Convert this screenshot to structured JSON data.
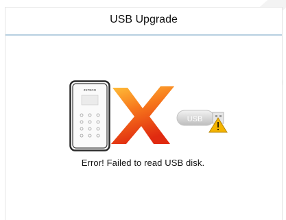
{
  "header": {
    "title": "USB Upgrade"
  },
  "device": {
    "screen_text": "ZKTECO"
  },
  "usb": {
    "label": "USB"
  },
  "status": {
    "message": "Error! Failed to read USB disk."
  },
  "icons": {
    "device": "terminal-device-icon",
    "error": "error-x-icon",
    "usb": "usb-drive-icon",
    "warning": "warning-icon"
  },
  "colors": {
    "header_rule": "#b7cfe0",
    "x_light": "#ffb62e",
    "x_dark": "#e83612",
    "warning": "#f4b400"
  }
}
